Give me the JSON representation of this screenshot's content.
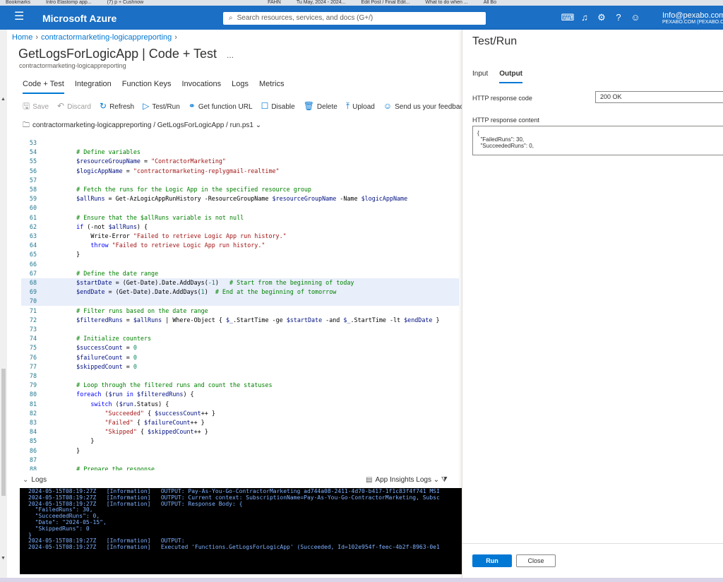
{
  "browser": {
    "bookmarks": [
      "Bookmarks",
      "Intro Elastomp app...",
      "(7) p + Cushnow",
      "",
      "",
      "",
      "",
      "",
      "",
      "",
      "FAHN",
      "Tu May, 2024 - 2024...",
      "Edit Post / Final Edit...",
      "What to do when ...",
      "All Bo"
    ]
  },
  "topbar": {
    "brand": "Microsoft Azure",
    "search_placeholder": "Search resources, services, and docs (G+/)",
    "user_email": "Info@pexabo.com",
    "user_org": "PEXABO.COM (PEXABO.CO"
  },
  "breadcrumb": [
    "Home",
    "contractormarketing-logicappreporting"
  ],
  "page": {
    "title_main": "GetLogsForLogicApp",
    "title_sub": "Code + Test",
    "dots": "...",
    "subtitle": "contractormarketing-logicappreporting"
  },
  "tabs": [
    "Code + Test",
    "Integration",
    "Function Keys",
    "Invocations",
    "Logs",
    "Metrics"
  ],
  "toolbar": [
    {
      "icon": "save-icon",
      "glyph": "🖫",
      "label": "Save",
      "disabled": true
    },
    {
      "icon": "discard-icon",
      "glyph": "↶",
      "label": "Discard",
      "disabled": true
    },
    {
      "icon": "refresh-icon",
      "glyph": "↻",
      "label": "Refresh",
      "disabled": false
    },
    {
      "icon": "play-icon",
      "glyph": "▷",
      "label": "Test/Run",
      "disabled": false
    },
    {
      "icon": "link-icon",
      "glyph": "⚭",
      "label": "Get function URL",
      "disabled": false
    },
    {
      "icon": "checkbox-icon",
      "glyph": "☐",
      "label": "Disable",
      "disabled": false
    },
    {
      "icon": "delete-icon",
      "glyph": "🗑",
      "label": "Delete",
      "disabled": false
    },
    {
      "icon": "upload-icon",
      "glyph": "⤒",
      "label": "Upload",
      "disabled": false
    },
    {
      "icon": "feedback-icon",
      "glyph": "☺",
      "label": "Send us your feedback",
      "disabled": false
    }
  ],
  "filepath": {
    "app": "contractormarketing-logicappreporting",
    "function": "GetLogsForLogicApp",
    "file": "run.ps1"
  },
  "editor": {
    "lines": [
      {
        "n": "53",
        "code": []
      },
      {
        "n": "54",
        "code": [
          [
            "cmt",
            "    # Define variables"
          ]
        ]
      },
      {
        "n": "55",
        "code": [
          [
            "var",
            "    $resourceGroupName"
          ],
          [
            "code",
            " = "
          ],
          [
            "str",
            "\"ContractorMarketing\""
          ]
        ]
      },
      {
        "n": "56",
        "code": [
          [
            "var",
            "    $logicAppName"
          ],
          [
            "code",
            " = "
          ],
          [
            "str",
            "\"contractormarketing-replygmail-realtime\""
          ]
        ]
      },
      {
        "n": "57",
        "code": []
      },
      {
        "n": "58",
        "code": [
          [
            "cmt",
            "    # Fetch the runs for the Logic App in the specified resource group"
          ]
        ]
      },
      {
        "n": "59",
        "code": [
          [
            "var",
            "    $allRuns"
          ],
          [
            "code",
            " = Get-AzLogicAppRunHistory -ResourceGroupName "
          ],
          [
            "var",
            "$resourceGroupName"
          ],
          [
            "code",
            " -Name "
          ],
          [
            "var",
            "$logicAppName"
          ]
        ]
      },
      {
        "n": "60",
        "code": []
      },
      {
        "n": "61",
        "code": [
          [
            "cmt",
            "    # Ensure that the $allRuns variable is not null"
          ]
        ]
      },
      {
        "n": "62",
        "code": [
          [
            "kw",
            "    if"
          ],
          [
            "code",
            " (-not "
          ],
          [
            "var",
            "$allRuns"
          ],
          [
            "code",
            ") {"
          ]
        ]
      },
      {
        "n": "63",
        "code": [
          [
            "code",
            "        Write-Error "
          ],
          [
            "str",
            "\"Failed to retrieve Logic App run history.\""
          ]
        ]
      },
      {
        "n": "64",
        "code": [
          [
            "kw",
            "        throw"
          ],
          [
            "code",
            " "
          ],
          [
            "str",
            "\"Failed to retrieve Logic App run history.\""
          ]
        ]
      },
      {
        "n": "65",
        "code": [
          [
            "code",
            "    }"
          ]
        ]
      },
      {
        "n": "66",
        "code": []
      },
      {
        "n": "67",
        "code": [
          [
            "cmt",
            "    # Define the date range"
          ]
        ]
      },
      {
        "n": "68",
        "hl": true,
        "code": [
          [
            "var",
            "    $startDate"
          ],
          [
            "code",
            " = (Get-Date).Date.AddDays("
          ],
          [
            "num",
            "-1"
          ],
          [
            "code",
            ")   "
          ],
          [
            "cmt",
            "# Start from the beginning of today"
          ]
        ]
      },
      {
        "n": "69",
        "hl": true,
        "code": [
          [
            "var",
            "    $endDate"
          ],
          [
            "code",
            " = (Get-Date).Date.AddDays("
          ],
          [
            "num",
            "1"
          ],
          [
            "code",
            ")  "
          ],
          [
            "cmt",
            "# End at the beginning of tomorrow"
          ]
        ]
      },
      {
        "n": "70",
        "hl": true,
        "code": []
      },
      {
        "n": "71",
        "code": [
          [
            "cmt",
            "    # Filter runs based on the date range"
          ]
        ]
      },
      {
        "n": "72",
        "code": [
          [
            "var",
            "    $filteredRuns"
          ],
          [
            "code",
            " = "
          ],
          [
            "var",
            "$allRuns"
          ],
          [
            "code",
            " | Where-Object { "
          ],
          [
            "var",
            "$_"
          ],
          [
            "code",
            ".StartTime -ge "
          ],
          [
            "var",
            "$startDate"
          ],
          [
            "code",
            " -and "
          ],
          [
            "var",
            "$_"
          ],
          [
            "code",
            ".StartTime -lt "
          ],
          [
            "var",
            "$endDate"
          ],
          [
            "code",
            " }"
          ]
        ]
      },
      {
        "n": "73",
        "code": []
      },
      {
        "n": "74",
        "code": [
          [
            "cmt",
            "    # Initialize counters"
          ]
        ]
      },
      {
        "n": "75",
        "code": [
          [
            "var",
            "    $successCount"
          ],
          [
            "code",
            " = "
          ],
          [
            "num",
            "0"
          ]
        ]
      },
      {
        "n": "76",
        "code": [
          [
            "var",
            "    $failureCount"
          ],
          [
            "code",
            " = "
          ],
          [
            "num",
            "0"
          ]
        ]
      },
      {
        "n": "77",
        "code": [
          [
            "var",
            "    $skippedCount"
          ],
          [
            "code",
            " = "
          ],
          [
            "num",
            "0"
          ]
        ]
      },
      {
        "n": "78",
        "code": []
      },
      {
        "n": "79",
        "code": [
          [
            "cmt",
            "    # Loop through the filtered runs and count the statuses"
          ]
        ]
      },
      {
        "n": "80",
        "code": [
          [
            "kw",
            "    foreach"
          ],
          [
            "code",
            " ("
          ],
          [
            "var",
            "$run"
          ],
          [
            "kw",
            " in "
          ],
          [
            "var",
            "$filteredRuns"
          ],
          [
            "code",
            ") {"
          ]
        ]
      },
      {
        "n": "81",
        "code": [
          [
            "kw",
            "        switch"
          ],
          [
            "code",
            " ("
          ],
          [
            "var",
            "$run"
          ],
          [
            "code",
            ".Status) {"
          ]
        ]
      },
      {
        "n": "82",
        "code": [
          [
            "str",
            "            \"Succeeded\""
          ],
          [
            "code",
            " { "
          ],
          [
            "var",
            "$successCount"
          ],
          [
            "code",
            "++ }"
          ]
        ]
      },
      {
        "n": "83",
        "code": [
          [
            "str",
            "            \"Failed\""
          ],
          [
            "code",
            " { "
          ],
          [
            "var",
            "$failureCount"
          ],
          [
            "code",
            "++ }"
          ]
        ]
      },
      {
        "n": "84",
        "code": [
          [
            "str",
            "            \"Skipped\""
          ],
          [
            "code",
            " { "
          ],
          [
            "var",
            "$skippedCount"
          ],
          [
            "code",
            "++ }"
          ]
        ]
      },
      {
        "n": "85",
        "code": [
          [
            "code",
            "        }"
          ]
        ]
      },
      {
        "n": "86",
        "code": [
          [
            "code",
            "    }"
          ]
        ]
      },
      {
        "n": "87",
        "code": []
      },
      {
        "n": "88",
        "code": [
          [
            "cmt",
            "    # Prepare the response"
          ]
        ]
      }
    ]
  },
  "logs": {
    "label": "Logs",
    "insights_label": "App Insights Logs",
    "lines": [
      "2024-05-15T08:19:27Z   [Information]   OUTPUT: Pay-As-You-Go-ContractorMarketing ad744a08-2411-4d70-b417-1f1c83f4f741 MSI",
      "2024-05-15T08:19:27Z   [Information]   OUTPUT: Current context: SubscriptionName=Pay-As-You-Go-ContractorMarketing, Subsc",
      "2024-05-15T08:19:27Z   [Information]   OUTPUT: Response Body: {",
      "  \"FailedRuns\": 30,",
      "  \"SucceededRuns\": 0,",
      "  \"Date\": \"2024-05-15\",",
      "  \"SkippedRuns\": 0",
      "}",
      "2024-05-15T08:19:27Z   [Information]   OUTPUT:",
      "2024-05-15T08:19:27Z   [Information]   Executed 'Functions.GetLogsForLogicApp' (Succeeded, Id=102e954f-feec-4b2f-8963-0e1"
    ]
  },
  "panel": {
    "title": "Test/Run",
    "tabs": [
      "Input",
      "Output"
    ],
    "active_tab": "Output",
    "response_code_label": "HTTP response code",
    "response_code": "200 OK",
    "response_content_label": "HTTP response content",
    "response_content": "{\n  \"FailedRuns\": 30,\n  \"SucceededRuns\": 0,",
    "run_label": "Run",
    "close_label": "Close"
  }
}
